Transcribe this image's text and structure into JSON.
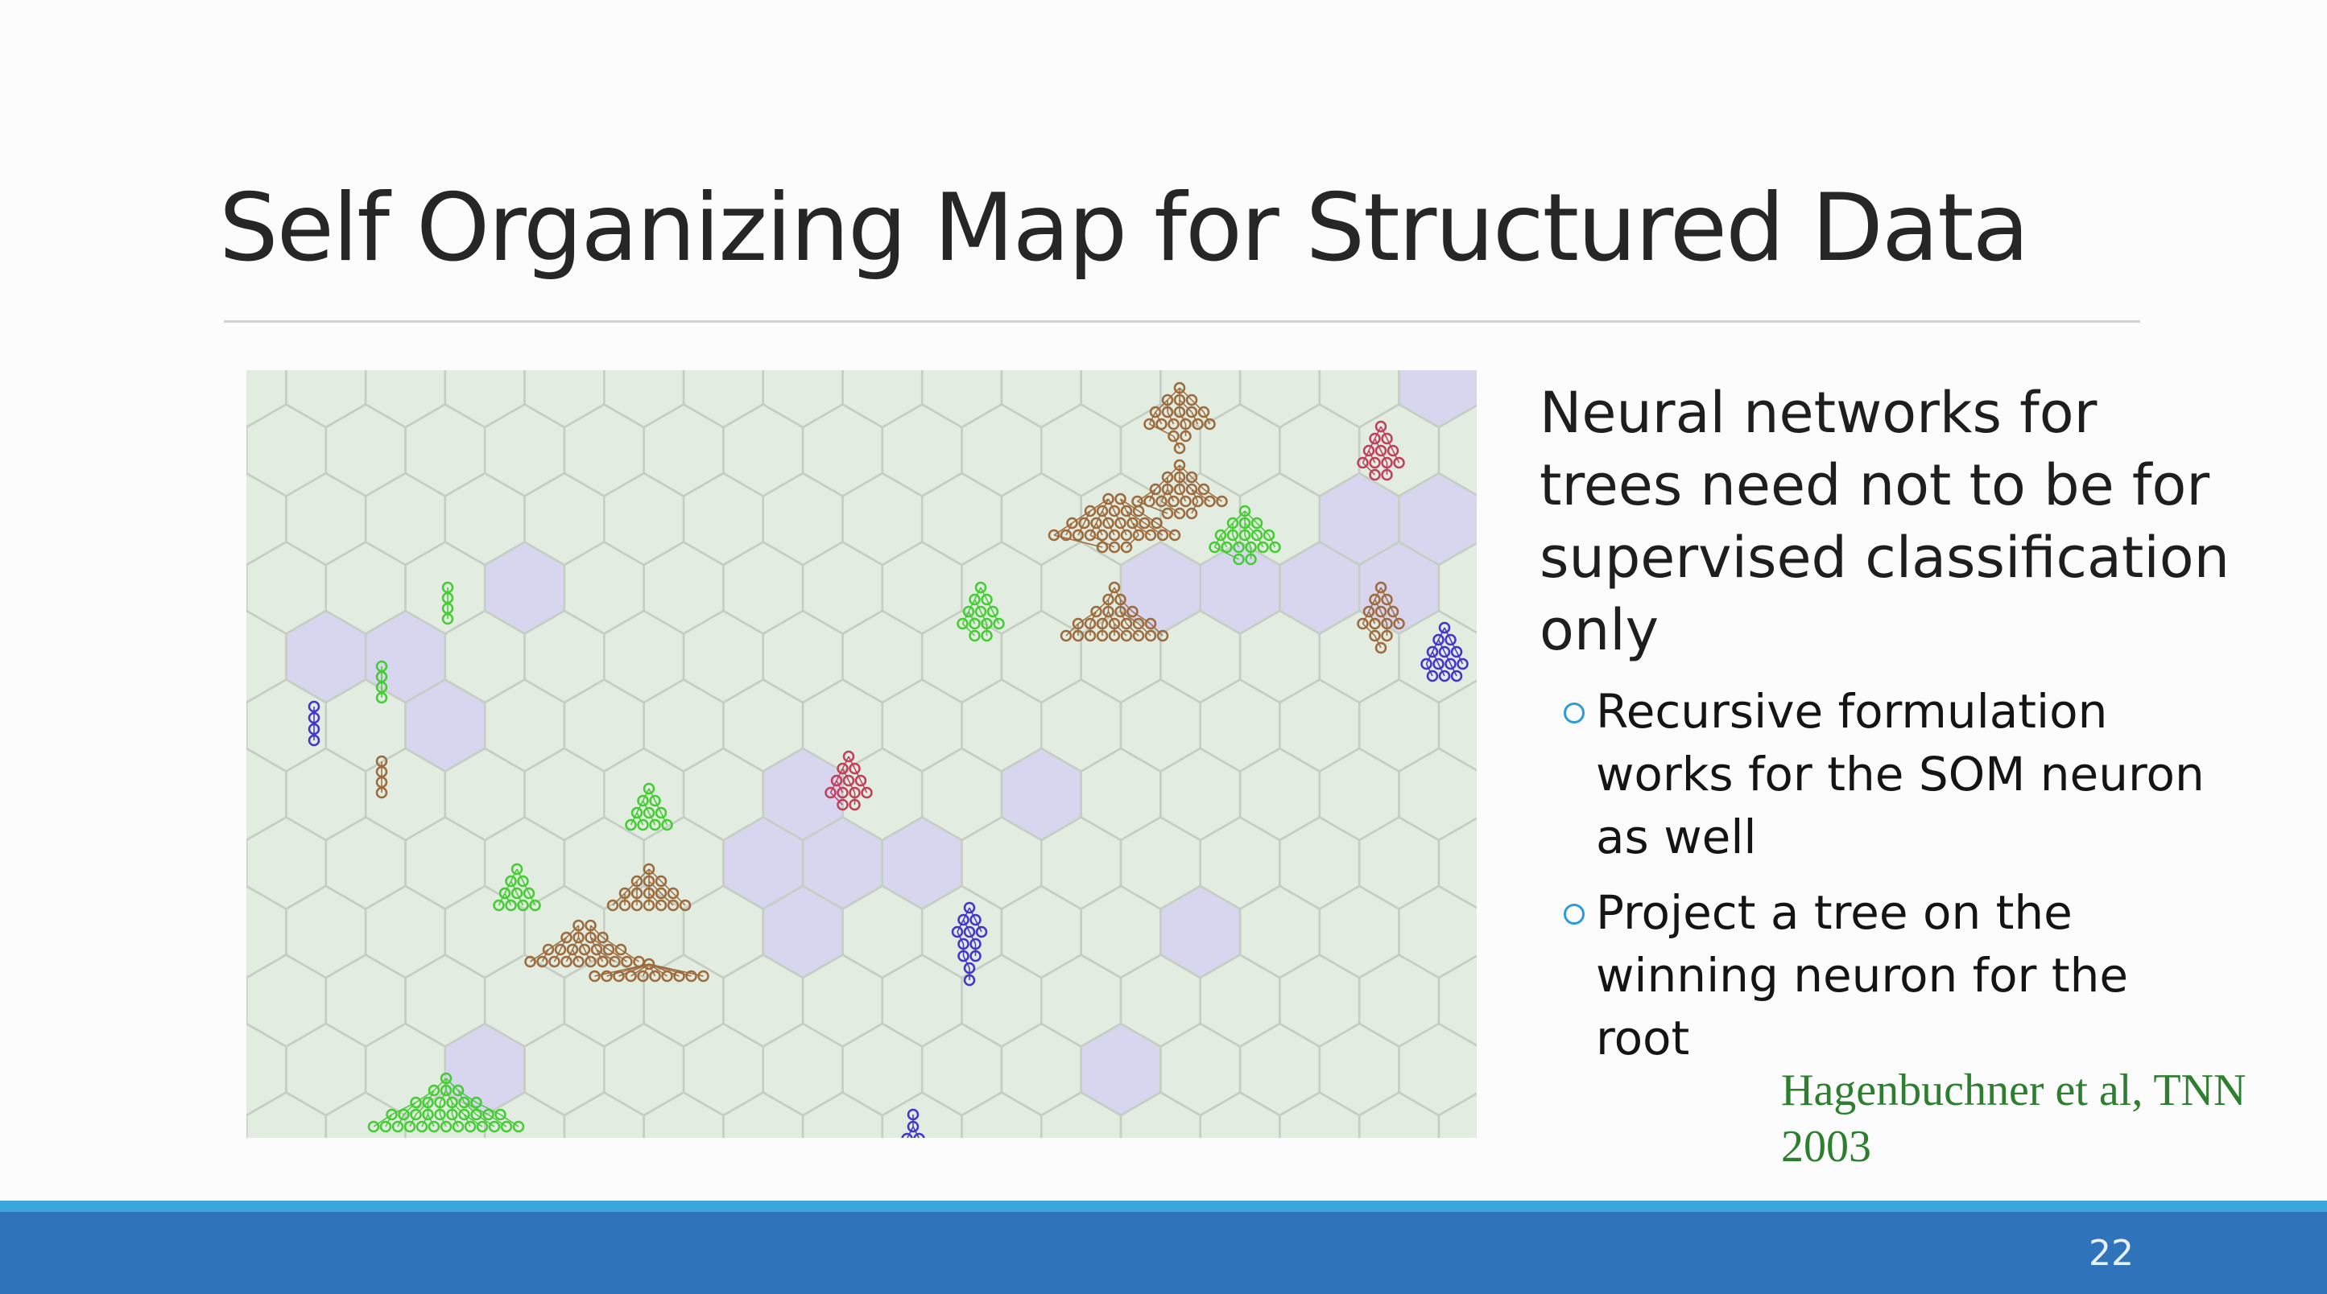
{
  "slide": {
    "title": "Self Organizing Map for Structured Data",
    "main_text": "Neural networks for trees need not to be for supervised classification only",
    "bullets": [
      "Recursive formulation works for the SOM neuron as well",
      "Project a tree on the winning neuron for the root"
    ],
    "citation": "Hagenbuchner et al, TNN 2003",
    "page_number": "22"
  },
  "figure": {
    "description": "SOM hexagonal map with tree structures projected on neurons",
    "colors": {
      "background": "#e2ece0",
      "grid_line": "#c4cec2",
      "active_cell": "#d8d6ef",
      "tree_brown": "#9c6a3c",
      "tree_green": "#44cc33",
      "tree_blue": "#4433cc",
      "tree_red": "#c0405a"
    },
    "active_cells": [
      [
        15,
        0
      ],
      [
        14,
        2
      ],
      [
        15,
        2
      ],
      [
        16,
        2
      ],
      [
        13,
        3
      ],
      [
        14,
        3
      ],
      [
        16,
        3
      ],
      [
        17,
        0
      ],
      [
        17,
        2
      ],
      [
        17,
        3
      ],
      [
        18,
        3
      ],
      [
        12,
        3
      ],
      [
        11,
        3
      ],
      [
        3,
        3
      ],
      [
        2,
        4
      ],
      [
        1,
        4
      ],
      [
        2,
        5
      ],
      [
        7,
        6
      ],
      [
        6,
        7
      ],
      [
        7,
        7
      ],
      [
        8,
        7
      ],
      [
        7,
        8
      ],
      [
        10,
        6
      ],
      [
        12,
        8
      ],
      [
        3,
        10
      ],
      [
        11,
        10
      ]
    ]
  },
  "footer": {
    "band_color": "#2f74ba",
    "strip_color": "#3ba6dc"
  }
}
